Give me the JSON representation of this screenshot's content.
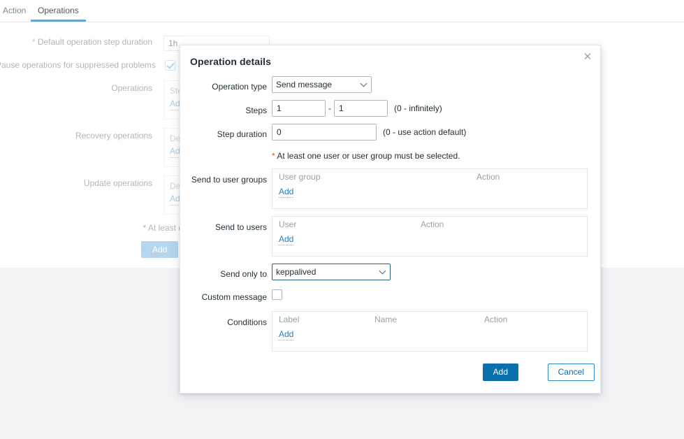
{
  "tabs": [
    {
      "label": "Action",
      "active": false
    },
    {
      "label": "Operations",
      "active": true
    }
  ],
  "background_form": {
    "default_step_duration": {
      "required_marker": "*",
      "label": "Default operation step duration",
      "value": "1h"
    },
    "pause_suppressed": {
      "label": "Pause operations for suppressed problems",
      "checked": true
    },
    "operations": {
      "label": "Operations",
      "header_truncated": "Ste",
      "add_label": "Ad"
    },
    "recovery_operations": {
      "label": "Recovery operations",
      "header_truncated": "De",
      "add_label": "Ad"
    },
    "update_operations": {
      "label": "Update operations",
      "header_truncated": "De",
      "add_label": "Ad"
    },
    "footer_note_truncated": "* At least o",
    "add_button_label": "Add"
  },
  "modal": {
    "title": "Operation details",
    "close_icon": "close-icon",
    "operation_type": {
      "label": "Operation type",
      "value": "Send message",
      "options": [
        "Send message"
      ]
    },
    "steps": {
      "label": "Steps",
      "from": "1",
      "separator": "-",
      "to": "1",
      "hint": "(0 - infinitely)"
    },
    "step_duration": {
      "label": "Step duration",
      "value": "0",
      "hint": "(0 - use action default)"
    },
    "requirement_note": {
      "star": "*",
      "text": " At least one user or user group must be selected."
    },
    "send_to_user_groups": {
      "label": "Send to user groups",
      "columns": [
        "User group",
        "Action"
      ],
      "rows": [],
      "add_label": "Add"
    },
    "send_to_users": {
      "label": "Send to users",
      "columns": [
        "User",
        "Action"
      ],
      "rows": [],
      "add_label": "Add"
    },
    "send_only_to": {
      "label": "Send only to",
      "value": "keppalived",
      "options": [
        "keppalived"
      ],
      "focused": true
    },
    "custom_message": {
      "label": "Custom message",
      "checked": false
    },
    "conditions": {
      "label": "Conditions",
      "columns": [
        "Label",
        "Name",
        "Action"
      ],
      "rows": [],
      "add_label": "Add"
    },
    "buttons": {
      "submit": "Add",
      "cancel": "Cancel"
    }
  },
  "colors": {
    "accent_blue": "#0a6fad",
    "link_blue": "#2b7dbd",
    "tab_underline": "#6ba4c6",
    "required_red": "#d45c3c",
    "muted_grey": "#97a1a8",
    "page_grey": "#f1f2f4"
  }
}
